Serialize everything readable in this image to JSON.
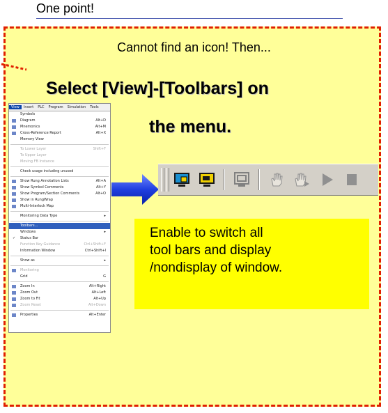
{
  "header": {
    "title": "One point!"
  },
  "panel": {
    "subtitle": "Cannot find an icon! Then...",
    "title_line1": "Select [View]-[Toolbars] on",
    "title_line2": "the menu."
  },
  "note": {
    "line1": "Enable to switch all",
    "line2": "tool bars and display",
    "line3": "/nondisplay of window."
  },
  "menu": {
    "bar": [
      "View",
      "Insert",
      "PLC",
      "Program",
      "Simulation",
      "Tools"
    ],
    "items": [
      {
        "label": "Symbols",
        "shortcut": ""
      },
      {
        "label": "Diagram",
        "shortcut": "Alt+D"
      },
      {
        "label": "Mnemonics",
        "shortcut": "Alt+M"
      },
      {
        "label": "Cross-Reference Report",
        "shortcut": "Alt+X"
      },
      {
        "label": "Memory View",
        "shortcut": ""
      },
      {
        "label": "To Lower Layer",
        "shortcut": "Shift+F"
      },
      {
        "label": "To Upper Layer",
        "shortcut": ""
      },
      {
        "label": "Moving FB Instance",
        "shortcut": ""
      },
      {
        "label": "Check usage including unused",
        "shortcut": ""
      },
      {
        "label": "Show Rung Annotation Lists",
        "shortcut": "Alt+A"
      },
      {
        "label": "Show Symbol Comments",
        "shortcut": "Alt+Y"
      },
      {
        "label": "Show Program/Section Comments",
        "shortcut": "Alt+O"
      },
      {
        "label": "Show in RungWrap",
        "shortcut": ""
      },
      {
        "label": "Multi-Interlock Map",
        "shortcut": ""
      },
      {
        "label": "Monitoring Data Type",
        "shortcut": ""
      },
      {
        "label": "Toolbars...",
        "shortcut": ""
      },
      {
        "label": "Windows",
        "shortcut": ""
      },
      {
        "label": "Status Bar",
        "shortcut": ""
      },
      {
        "label": "Function Key Guidance",
        "shortcut": "Ctrl+Shift+F"
      },
      {
        "label": "Information Window",
        "shortcut": "Ctrl+Shift+I"
      },
      {
        "label": "Show as",
        "shortcut": ""
      },
      {
        "label": "Monitoring",
        "shortcut": ""
      },
      {
        "label": "Grid",
        "shortcut": "G"
      },
      {
        "label": "Zoom In",
        "shortcut": "Alt+Right"
      },
      {
        "label": "Zoom Out",
        "shortcut": "Alt+Left"
      },
      {
        "label": "Zoom to Fit",
        "shortcut": "Alt+Up"
      },
      {
        "label": "Zoom Reset",
        "shortcut": "Alt+Down"
      },
      {
        "label": "Properties",
        "shortcut": "Alt+Enter"
      }
    ]
  },
  "icons": [
    "grip-icon",
    "screen-lock-icon",
    "screen-display-icon",
    "screen-icon",
    "hand-icon",
    "hand-run-icon",
    "play-icon",
    "stop-icon"
  ],
  "colors": {
    "panel_bg": "#ffff99",
    "panel_border": "#e02000",
    "note_bg": "#ffff00",
    "arrow": "#1f3fe0"
  }
}
